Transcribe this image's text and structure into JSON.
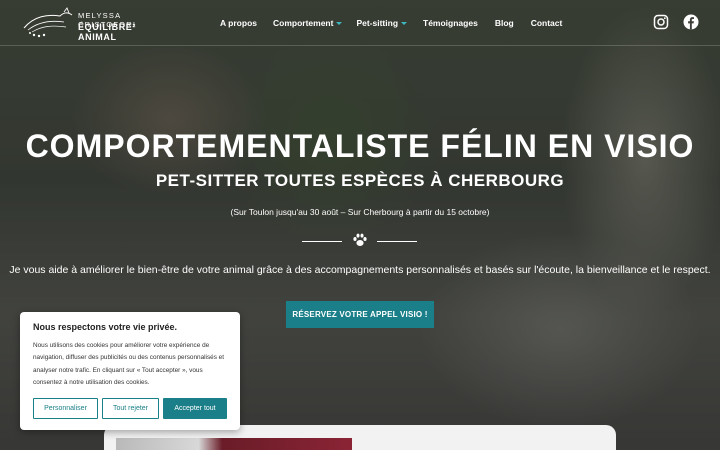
{
  "brand": {
    "name_top": "MELYSSA CRISTOFORI",
    "name_bottom": "ÉQUILIBRE² ANIMAL"
  },
  "nav": {
    "items": [
      {
        "label": "A propos",
        "dropdown": false
      },
      {
        "label": "Comportement",
        "dropdown": true
      },
      {
        "label": "Pet-sitting",
        "dropdown": true
      },
      {
        "label": "Témoignages",
        "dropdown": false
      },
      {
        "label": "Blog",
        "dropdown": false
      },
      {
        "label": "Contact",
        "dropdown": false
      }
    ],
    "social": [
      "instagram-icon",
      "facebook-icon"
    ]
  },
  "hero": {
    "title": "COMPORTEMENTALISTE FÉLIN EN VISIO",
    "subtitle": "PET-SITTER TOUTES ESPÈCES À CHERBOURG",
    "note": "(Sur Toulon jusqu'au 30 août – Sur Cherbourg à partir du 15 octobre)",
    "divider_icon": "paw-icon",
    "description": "Je vous aide à améliorer le bien-être de votre animal grâce à des accompagnements personnalisés et basés sur l'écoute, la bienveillance et le respect.",
    "cta_label": "RÉSERVEZ VOTRE APPEL VISIO !"
  },
  "cookie_banner": {
    "title": "Nous respectons votre vie privée.",
    "text": "Nous utilisons des cookies pour améliorer votre expérience de navigation, diffuser des publicités ou des contenus personnalisés et analyser notre trafic. En cliquant sur « Tout accepter », vous consentez à notre utilisation des cookies.",
    "customize_label": "Personnaliser",
    "reject_label": "Tout rejeter",
    "accept_label": "Accepter tout"
  },
  "colors": {
    "accent": "#1a7f88",
    "caret": "#3fb7c3",
    "text_on_hero": "#ffffff"
  }
}
